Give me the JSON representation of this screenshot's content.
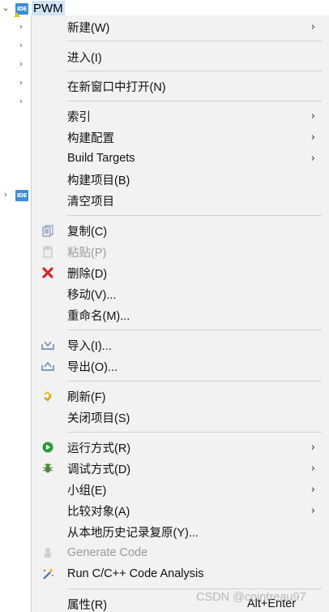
{
  "tree": {
    "root_label": "PWM",
    "ide_badge": "IDE",
    "second_badge": "IDE"
  },
  "menu": {
    "new": "新建(W)",
    "go_into": "进入(I)",
    "open_new_window": "在新窗口中打开(N)",
    "index": "索引",
    "build_config": "构建配置",
    "build_targets": "Build Targets",
    "build_project": "构建项目(B)",
    "clean_project": "清空项目",
    "copy": "复制(C)",
    "paste": "粘贴(P)",
    "delete": "删除(D)",
    "move": "移动(V)...",
    "rename": "重命名(M)...",
    "import": "导入(I)...",
    "export": "导出(O)...",
    "refresh": "刷新(F)",
    "close_project": "关闭项目(S)",
    "run_as": "运行方式(R)",
    "debug_as": "调试方式(D)",
    "team": "小组(E)",
    "compare_with": "比较对象(A)",
    "restore_local_history": "从本地历史记录复原(Y)...",
    "generate_code": "Generate Code",
    "code_analysis": "Run C/C++ Code Analysis",
    "properties": "属性(R)",
    "properties_shortcut": "Alt+Enter"
  },
  "watermark": "CSDN @cointreau97",
  "submenu_arrow": "›"
}
